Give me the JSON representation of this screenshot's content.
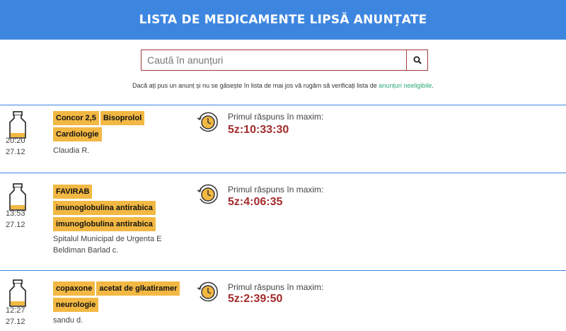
{
  "header": {
    "title": "LISTA DE MEDICAMENTE LIPSĂ ANUNȚATE"
  },
  "search": {
    "placeholder": "Caută în anunțuri",
    "icon": "search-icon"
  },
  "notice": {
    "text": "Dacă ați pus un anunț și nu se găsește în lista de mai jos vă rugăm să verificați lista de ",
    "link": "anunțuri neeligibile",
    "suffix": "."
  },
  "colors": {
    "header": "#3d86e0",
    "tag": "#f2b843",
    "countdown": "#a32b2b",
    "link": "#2aa874"
  },
  "entries": [
    {
      "time": "20:20",
      "date": "27.12",
      "tags": [
        "Concor 2,5",
        "Bisoprolol",
        "Cardiologie"
      ],
      "author": "Claudia R.",
      "response_label": "Primul răspuns în maxim:",
      "countdown": "5z:10:33:30"
    },
    {
      "time": "13:53",
      "date": "27.12",
      "tags": [
        "FAVIRAB",
        "imunoglobulina antirabica",
        "imunoglobulina antirabica"
      ],
      "author": "Spitalul Municipal de Urgenta E Beldiman Barlad c.",
      "response_label": "Primul răspuns în maxim:",
      "countdown": "5z:4:06:35"
    },
    {
      "time": "12:27",
      "date": "27.12",
      "tags": [
        "copaxone",
        "acetat de glkatiramer",
        "neurologie"
      ],
      "author": "sandu d.",
      "response_label": "Primul răspuns în maxim:",
      "countdown": "5z:2:39:50"
    }
  ]
}
